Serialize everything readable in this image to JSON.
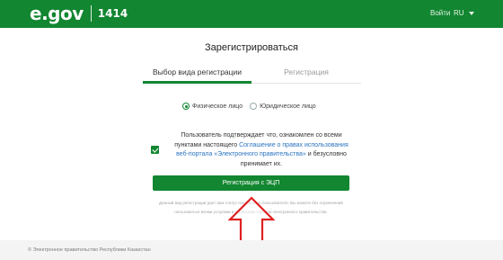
{
  "header": {
    "logo_text": "e.gov",
    "phone": "1414",
    "login_label": "Войти",
    "language": "RU"
  },
  "main": {
    "title": "Зарегистрироваться",
    "tabs": [
      {
        "label": "Выбор вида регистрации",
        "active": true
      },
      {
        "label": "Регистрация",
        "active": false
      }
    ],
    "person_types": [
      {
        "label": "Физическое лицо",
        "selected": true
      },
      {
        "label": "Юридическое лицо",
        "selected": false
      }
    ],
    "consent": {
      "checked": true,
      "text_before": "Пользователь подтверждает что, ознакомлен со всеми пунктами настоящего ",
      "link_text": "Соглашение о правах использования веб-портала «Электронного правительства»",
      "text_after": " и безусловно принимает их."
    },
    "register_button_label": "Регистрация с ЭЦП",
    "notice": "Данный вид регистрации дает вам статус постоянного пользователя. Вы можете без ограничений пользоваться всеми услугами и сервисами портала электронного правительства."
  },
  "footer": {
    "copyright": "© Электронное правительство Республики Казахстан"
  },
  "colors": {
    "brand_green": "#128630",
    "link_blue": "#2a73c0",
    "annotation_red": "#e02020"
  },
  "icons": {
    "language_dropdown": "chevron-down-icon",
    "annotation": "arrow-up-icon"
  }
}
